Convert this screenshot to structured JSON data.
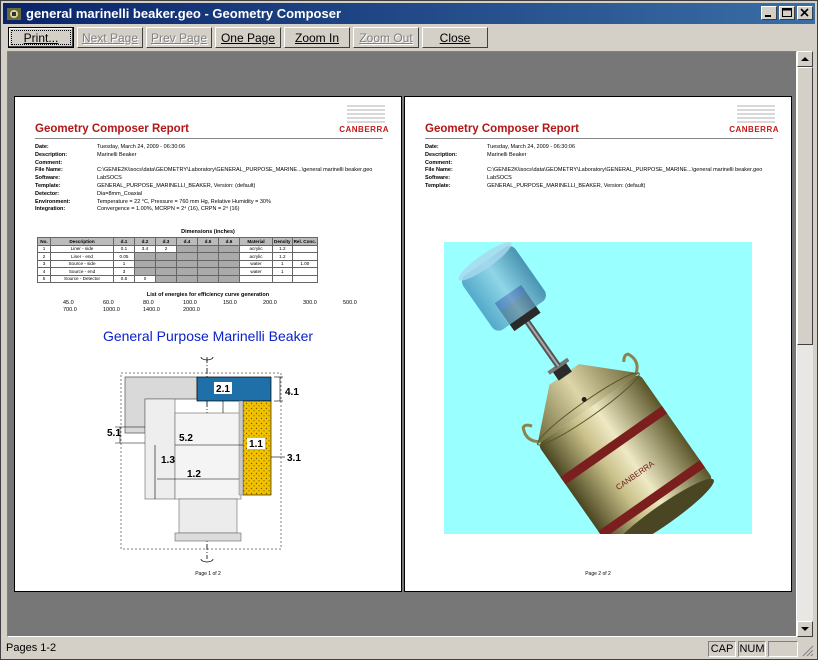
{
  "window": {
    "title": "general marinelli beaker.geo - Geometry Composer"
  },
  "toolbar": {
    "print": "Print...",
    "next_page": "Next Page",
    "prev_page": "Prev Page",
    "one_page": "One Page",
    "zoom_in": "Zoom In",
    "zoom_out": "Zoom Out",
    "close": "Close"
  },
  "report": {
    "title": "Geometry Composer Report",
    "logo": "CANBERRA",
    "labels": {
      "date": "Date:",
      "description": "Description:",
      "comment": "Comment:",
      "file_name": "File Name:",
      "software": "Software:",
      "template": "Template:",
      "detector": "Detector:",
      "environment": "Environment:",
      "integration": "Integration:"
    },
    "values": {
      "date": "Tuesday, March 24, 2009 - 06:30:06",
      "description": "Marinelli Beaker",
      "comment": "",
      "file_name": "C:\\GENIE2K\\isocs\\data\\GEOMETRY\\Laboratory\\GENERAL_PURPOSE_MARINE...\\general marinelli beaker.geo",
      "software": "LabSOCS",
      "template": "GENERAL_PURPOSE_MARINELLI_BEAKER, Version: (default)",
      "detector": "Dia=8mm_Coaxial",
      "environment": "Temperature = 22 °C, Pressure = 760 mm Hg, Relative Humidity = 30%",
      "integration": "Convergence = 1.00%, MCRPN = 2⁴ (16), CRPN = 2⁴ (16)"
    },
    "dimensions_title": "Dimensions (inches)",
    "dim_headers": [
      "No.",
      "Description",
      "d.1",
      "d.2",
      "d.3",
      "d.4",
      "d.5",
      "d.6",
      "Material",
      "Density",
      "Rel. Conc."
    ],
    "dim_rows": [
      [
        "1",
        "Liner - side",
        "0.1",
        "3.4",
        "2",
        "",
        "",
        "",
        "acrylic",
        "1.2",
        ""
      ],
      [
        "2",
        "Liner - end",
        "0.05",
        "",
        "",
        "",
        "",
        "",
        "acrylic",
        "1.2",
        ""
      ],
      [
        "3",
        "Source - side",
        "1",
        "",
        "",
        "",
        "",
        "",
        "water",
        "1",
        "1.00"
      ],
      [
        "4",
        "Source - end",
        "3",
        "",
        "",
        "",
        "",
        "",
        "water",
        "1",
        ""
      ],
      [
        "5",
        "Source - Detector",
        "0.5",
        "0",
        "",
        "",
        "",
        "",
        "",
        "",
        ""
      ]
    ],
    "energies_title": "List of energies for efficiency curve generation",
    "energies_row1": [
      "45.0",
      "60.0",
      "80.0",
      "100.0",
      "150.0",
      "200.0",
      "300.0",
      "500.0"
    ],
    "energies_row2": [
      "700.0",
      "1000.0",
      "1400.0",
      "2000.0"
    ],
    "diagram_title": "General Purpose Marinelli Beaker",
    "diagram_labels": [
      "2.1",
      "4.1",
      "5.1",
      "5.2",
      "1.1",
      "3.1",
      "1.3",
      "1.2"
    ],
    "page1_label": "Page 1 of 2",
    "page2_label": "Page 2 of 2",
    "canister_brand": "CANBERRA"
  },
  "status": {
    "pages": "Pages 1-2",
    "cap": "CAP",
    "num": "NUM"
  },
  "colors": {
    "title_red": "#b31818",
    "diagram_blue": "#0a22c8",
    "render_bg": "#99ffff",
    "titlebar_start": "#0a246a"
  }
}
